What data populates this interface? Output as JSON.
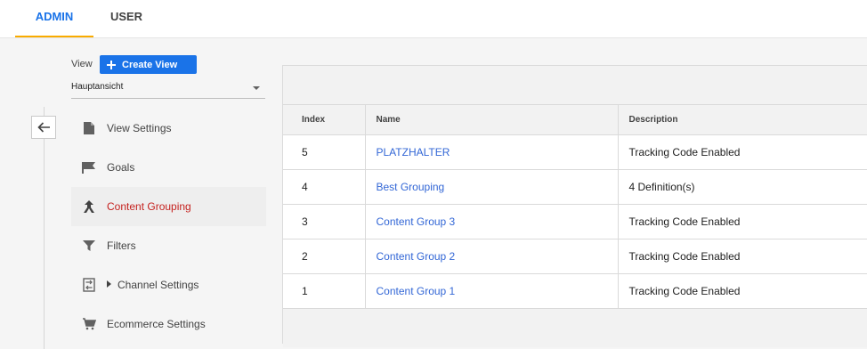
{
  "tabs": [
    {
      "label": "ADMIN",
      "active": true
    },
    {
      "label": "USER",
      "active": false
    }
  ],
  "view": {
    "label": "View",
    "create_button": "Create View",
    "selected": "Hauptansicht"
  },
  "menu": [
    {
      "label": "View Settings",
      "icon": "document-icon"
    },
    {
      "label": "Goals",
      "icon": "flag-icon"
    },
    {
      "label": "Content Grouping",
      "icon": "content-grouping-icon",
      "active": true
    },
    {
      "label": "Filters",
      "icon": "filter-icon"
    },
    {
      "label": "Channel Settings",
      "icon": "channel-settings-icon",
      "expandable": true
    },
    {
      "label": "Ecommerce Settings",
      "icon": "cart-icon"
    }
  ],
  "table": {
    "headers": {
      "index": "Index",
      "name": "Name",
      "description": "Description"
    },
    "rows": [
      {
        "index": "5",
        "name": "PLATZHALTER",
        "description": "Tracking Code Enabled"
      },
      {
        "index": "4",
        "name": "Best Grouping",
        "description": "4 Definition(s)"
      },
      {
        "index": "3",
        "name": "Content Group 3",
        "description": "Tracking Code Enabled"
      },
      {
        "index": "2",
        "name": "Content Group 2",
        "description": "Tracking Code Enabled"
      },
      {
        "index": "1",
        "name": "Content Group 1",
        "description": "Tracking Code Enabled"
      }
    ]
  },
  "colors": {
    "accent_blue": "#1a73e8",
    "tab_underline": "#f9ab00",
    "active_menu_text": "#c5221f",
    "link": "#3367d6"
  }
}
